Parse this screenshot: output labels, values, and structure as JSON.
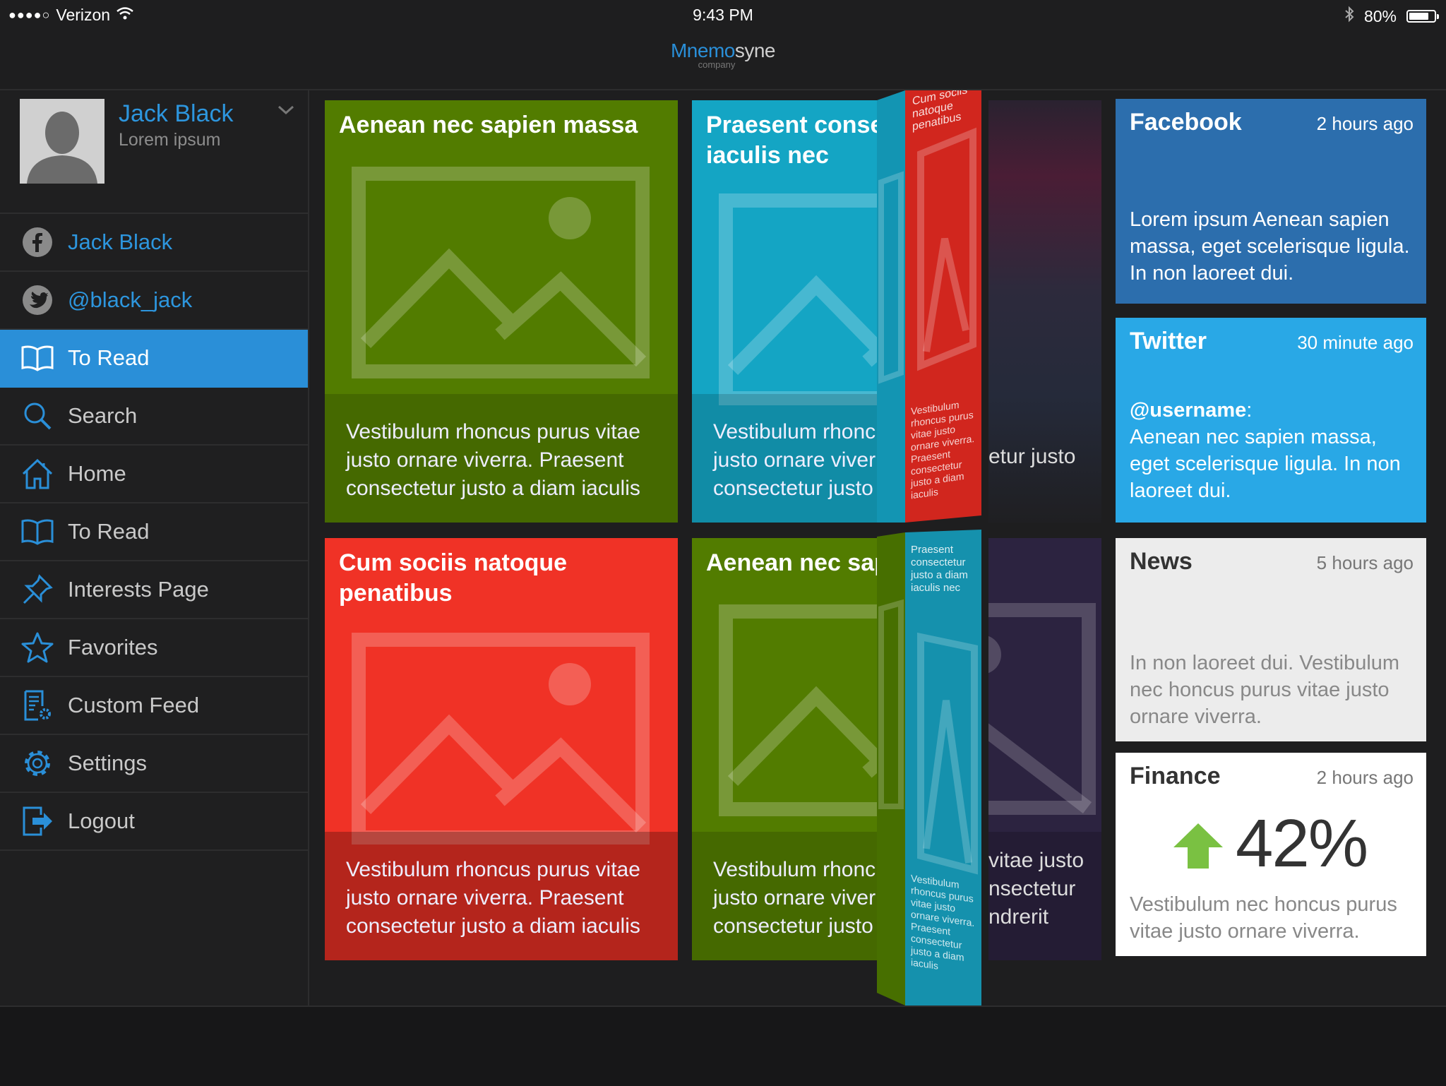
{
  "status": {
    "carrier": "Verizon",
    "time": "9:43 PM",
    "battery": "80%",
    "battery_level": 0.8
  },
  "app": {
    "name_part1": "Mnemo",
    "name_part2": "syne",
    "subtitle": "company"
  },
  "profile": {
    "name": "Jack Black",
    "subtitle": "Lorem ipsum"
  },
  "nav": [
    {
      "label": "Jack Black",
      "icon": "facebook-icon"
    },
    {
      "label": "@black_jack",
      "icon": "twitter-icon"
    },
    {
      "label": "To Read",
      "icon": "open-book-icon",
      "active": true
    },
    {
      "label": "Search",
      "icon": "search-icon"
    },
    {
      "label": "Home",
      "icon": "home-icon"
    },
    {
      "label": "To Read",
      "icon": "open-book-icon"
    },
    {
      "label": "Interests Page",
      "icon": "pushpin-icon"
    },
    {
      "label": "Favorites",
      "icon": "star-icon"
    },
    {
      "label": "Custom Feed",
      "icon": "feed-settings-icon"
    },
    {
      "label": "Settings",
      "icon": "gear-icon"
    },
    {
      "label": "Logout",
      "icon": "logout-icon"
    }
  ],
  "tiles": [
    {
      "title": "Aenean nec sapien massa",
      "body": "Vestibulum rhoncus purus vitae justo ornare viverra. Praesent consectetur justo a diam iaculis",
      "color": "#527c00"
    },
    {
      "title": "Praesent consectetur diam iaculis nec",
      "body": "Vestibulum rhoncus purus vitae justo ornare viverra. Praesent consectetur justo a diam iaculis",
      "color": "#14a5c4"
    },
    {
      "title": "Cum sociis natoque penatibus",
      "body": "Vestibulum rhoncus purus vitae justo ornare viverra. Praesent consectetur justo a diam iaculis",
      "color": "#f03226"
    },
    {
      "title": "Aenean nec sapien massa",
      "body": "Vestibulum rhoncus purus vitae justo ornare viverra. Praesent consectetur justo a diam iaculis",
      "color": "#527c00"
    }
  ],
  "partial": {
    "top_text": "etur justo",
    "bottom_lines": [
      "vitae justo",
      "nsectetur",
      "ndrerit"
    ]
  },
  "fold": {
    "top_title": "Cum sociis natoque penatibus",
    "bottom_title": "Praesent consectetur justo a diam iaculis nec",
    "small_text": "Vestibulum rhoncus purus vitae justo ornare viverra. Praesent consectetur justo a diam iaculis"
  },
  "cards": {
    "facebook": {
      "title": "Facebook",
      "time": "2 hours ago",
      "text": "Lorem ipsum Aenean sapien massa, eget scelerisque ligula. In non laoreet dui.",
      "color": "#2c6ead"
    },
    "twitter": {
      "title": "Twitter",
      "time": "30 minute ago",
      "handle": "@username",
      "text": "Aenean nec sapien massa, eget scelerisque ligula. In non laoreet dui.",
      "color": "#29a8e6"
    },
    "news": {
      "title": "News",
      "time": "5 hours ago",
      "text": "In non laoreet dui. Vestibulum nec honcus purus vitae justo ornare viverra.",
      "color": "#ececec"
    },
    "finance": {
      "title": "Finance",
      "time": "2 hours ago",
      "value": "42%",
      "text": "Vestibulum nec honcus purus vitae justo ornare viverra.",
      "color": "#ffffff",
      "arrow_color": "#7ac142"
    }
  }
}
